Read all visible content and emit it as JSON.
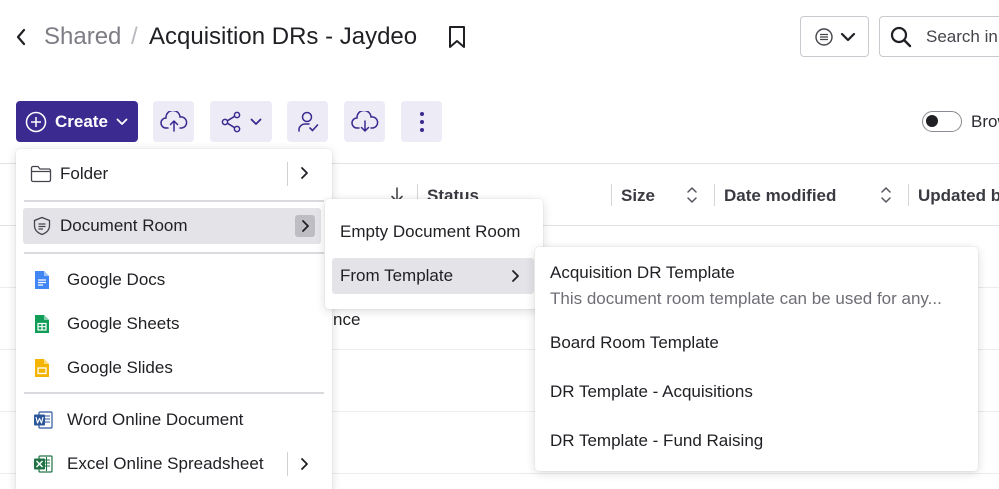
{
  "header": {
    "breadcrumb_parent": "Shared",
    "breadcrumb_separator": "/",
    "title": "Acquisition DRs - Jaydeo",
    "search_placeholder": "Search in"
  },
  "toolbar": {
    "create_label": "Create",
    "browse_toggle_label": "Brow",
    "accent_color": "#3b2a8f"
  },
  "table": {
    "columns": [
      "Status",
      "Size",
      "Date modified",
      "Updated b"
    ],
    "visible_cell_fragment": "nce"
  },
  "create_menu": {
    "items": [
      {
        "label": "Folder",
        "icon": "folder-icon",
        "has_submenu": true
      },
      {
        "label": "Document Room",
        "icon": "document-room-icon",
        "has_submenu": true,
        "active": true
      },
      {
        "label": "Google Docs",
        "icon": "google-docs-icon"
      },
      {
        "label": "Google Sheets",
        "icon": "google-sheets-icon"
      },
      {
        "label": "Google Slides",
        "icon": "google-slides-icon"
      },
      {
        "label": "Word Online Document",
        "icon": "word-icon"
      },
      {
        "label": "Excel Online Spreadsheet",
        "icon": "excel-icon",
        "has_submenu": true
      }
    ]
  },
  "document_room_menu": {
    "items": [
      {
        "label": "Empty Document Room"
      },
      {
        "label": "From Template",
        "has_submenu": true,
        "active": true
      }
    ]
  },
  "template_menu": {
    "items": [
      {
        "label": "Acquisition DR Template",
        "description": "This document room template can be used for any..."
      },
      {
        "label": "Board Room Template"
      },
      {
        "label": "DR Template - Acquisitions"
      },
      {
        "label": "DR Template - Fund Raising"
      }
    ]
  }
}
